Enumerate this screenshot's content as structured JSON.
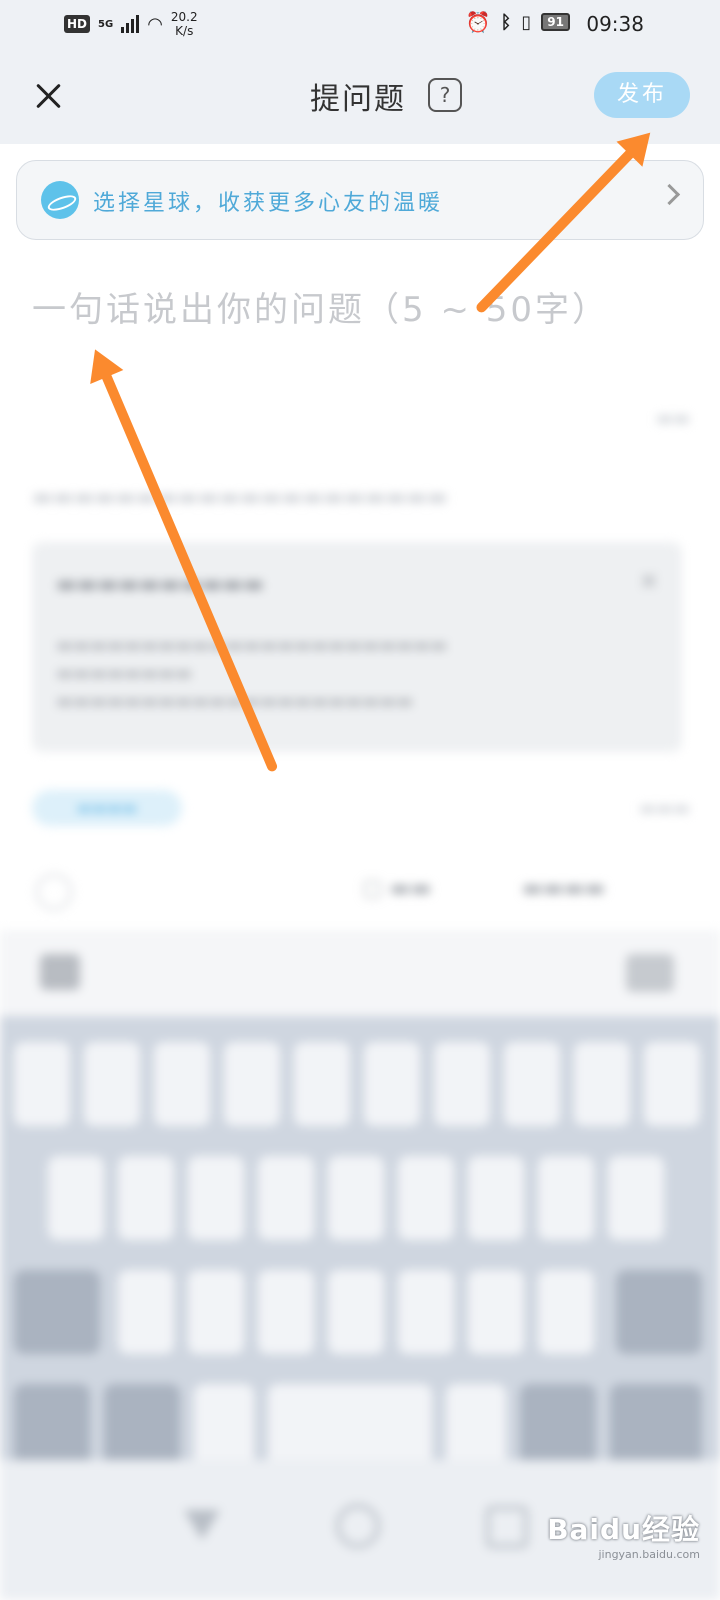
{
  "status_bar": {
    "network": "HD",
    "signal_type": "5G",
    "speed": "20.2",
    "speed_unit": "K/s",
    "battery": "91",
    "time": "09:38"
  },
  "header": {
    "title": "提问题",
    "help_label": "?",
    "publish_label": "发布"
  },
  "planet_banner": {
    "text": "选择星球，收获更多心友的温暖"
  },
  "question_input": {
    "placeholder": "一句话说出你的问题（5 ~ 50字）"
  },
  "watermark": {
    "logo": "Baidu经验",
    "url": "jingyan.baidu.com"
  },
  "colors": {
    "accent": "#4fa9d8",
    "publish_button": "#a9d9f5",
    "annotation_arrow": "#fb8a2e"
  }
}
